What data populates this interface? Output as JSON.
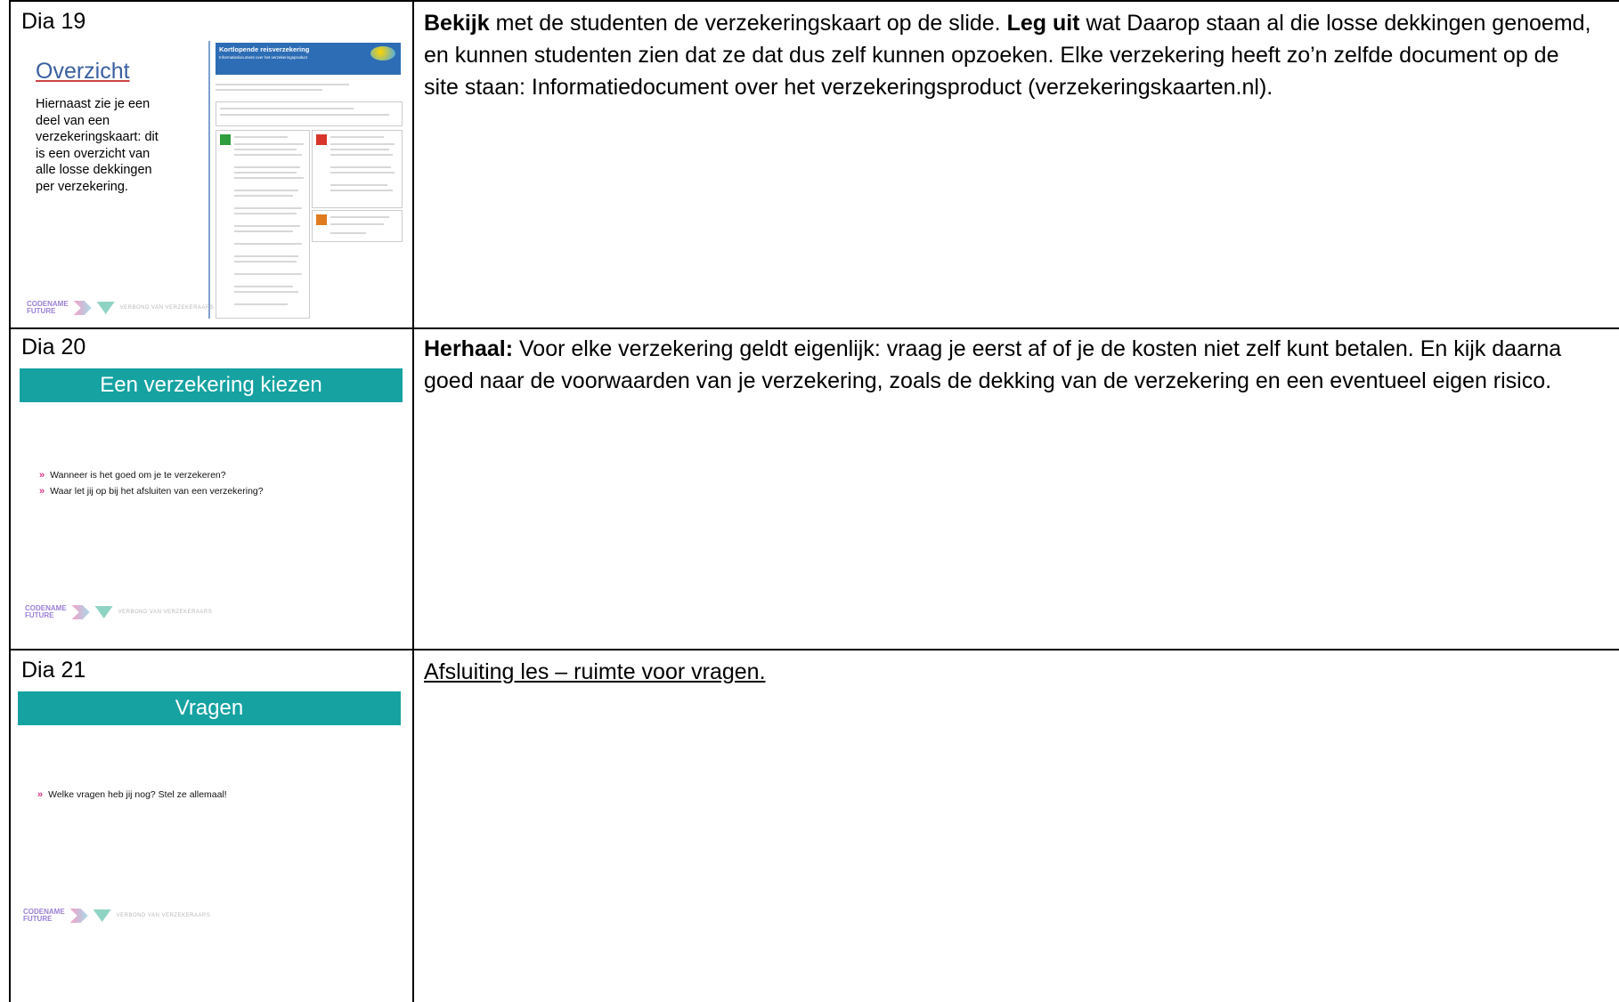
{
  "rows": [
    {
      "label": "Dia 19",
      "slide": {
        "title": "Overzicht",
        "text": "Hiernaast zie je een deel van een verzekeringskaart: dit is een overzicht van alle losse dekkingen per verzekering.",
        "doc_title": "Kortlopende reisverzekering",
        "doc_subtitle": "Informatiedocument over het verzekeringsproduct",
        "logo_text_1": "CODENAME",
        "logo_text_2": "FUTURE",
        "logo_text_3": "VERBOND VAN VERZEKERAARS"
      },
      "notes": {
        "b1": "Bekijk",
        "t1": " met de studenten de verzekeringskaart op de slide. ",
        "b2": "Leg uit",
        "t2": " wat Daarop staan al die losse dekkingen genoemd, en kunnen studenten zien dat ze dat dus zelf kunnen opzoeken. Elke verzekering heeft zo’n zelfde document op de site staan: Informatiedocument over het verzekeringsproduct (verzekeringskaarten.nl)."
      }
    },
    {
      "label": "Dia 20",
      "slide": {
        "title": "Een verzekering kiezen",
        "bullets": [
          "Wanneer is het goed om je te verzekeren?",
          "Waar let jij op bij het afsluiten van een verzekering?"
        ],
        "logo_text_1": "CODENAME",
        "logo_text_2": "FUTURE",
        "logo_text_3": "VERBOND VAN VERZEKERAARS"
      },
      "notes": {
        "b1": "Herhaal:",
        "t1": " Voor elke verzekering geldt eigenlijk: vraag je eerst af of je de kosten niet zelf kunt betalen. En kijk daarna goed naar de voorwaarden van je verzekering, zoals de dekking van de verzekering en een eventueel eigen risico."
      }
    },
    {
      "label": "Dia 21",
      "slide": {
        "title": "Vragen",
        "bullets": [
          "Welke vragen heb jij nog? Stel ze allemaal!"
        ],
        "logo_text_1": "CODENAME",
        "logo_text_2": "FUTURE",
        "logo_text_3": "VERBOND VAN VERZEKERAARS"
      },
      "notes": {
        "u1": "Afsluiting les – ruimte voor vragen."
      }
    }
  ],
  "colors": {
    "teal": "#17a2a2",
    "accent_pink": "#d63384",
    "doc_blue": "#2d6db5"
  }
}
